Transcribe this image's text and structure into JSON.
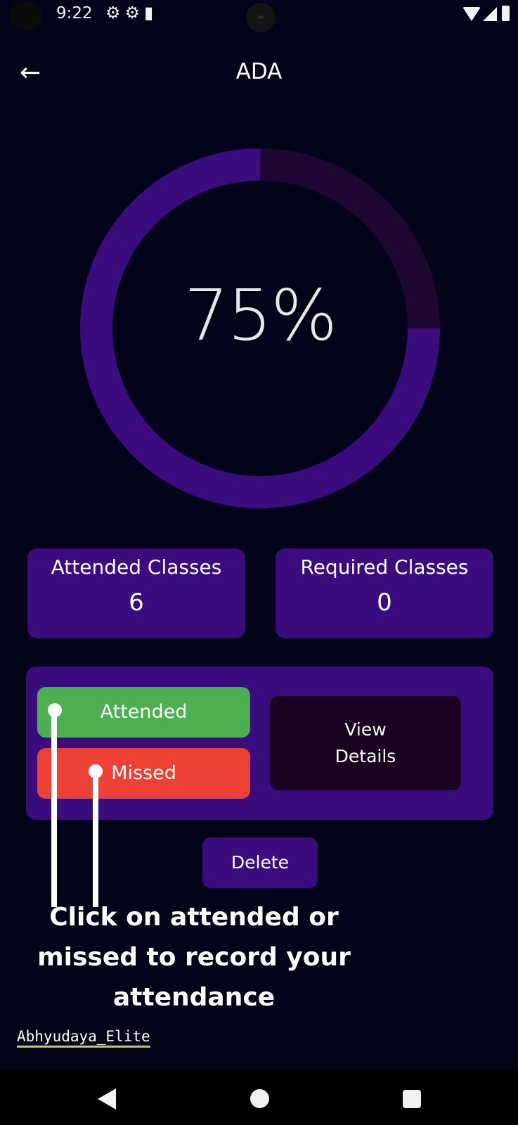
{
  "status_bar": {
    "time": "9:22",
    "icons": [
      "gear-icon",
      "gear-icon",
      "sd-card-icon"
    ]
  },
  "header": {
    "title": "ADA",
    "back_icon": "arrow-left-icon"
  },
  "attendance": {
    "percent_label": "75%",
    "progress_fraction": 0.75,
    "ring_fill_color": "#3b0c7e",
    "ring_track_color": "#1f0733"
  },
  "stats": {
    "attended": {
      "label": "Attended Classes",
      "value": "6"
    },
    "required": {
      "label": "Required Classes",
      "value": "0"
    }
  },
  "actions": {
    "attended_label": "Attended",
    "missed_label": "Missed",
    "view_details_label": "View Details",
    "delete_label": "Delete"
  },
  "colors": {
    "attended_button": "#4caf50",
    "missed_button": "#ee4136",
    "card": "#3b0c7e",
    "background": "#03031a"
  },
  "overlay": {
    "caption": "Click on attended or missed to record your attendance",
    "watermark": "Abhyudaya_Elite"
  },
  "nav_bar": {
    "icons": [
      "back-triangle-icon",
      "home-circle-icon",
      "recents-square-icon"
    ]
  }
}
